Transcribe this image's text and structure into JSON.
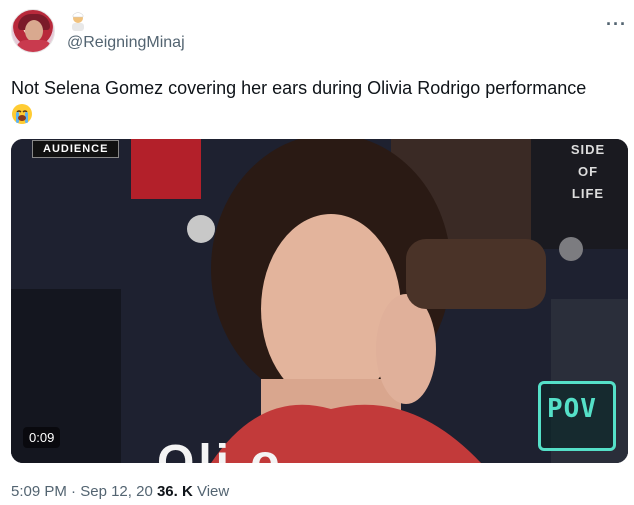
{
  "tweet": {
    "handle": "@ReigningMinaj",
    "text": "Not Selena Gomez covering her ears during Olivia Rodrigo performance",
    "more_icon": "more-icon"
  },
  "video": {
    "badge": "AUDIENCE",
    "duration": "0:09",
    "caption_overlay": "Oli   o",
    "logo_text": "POV",
    "side_text": "SIDE OF LIFE"
  },
  "meta": {
    "time": "5:09 PM",
    "separator": "·",
    "date": "Sep 12, 20",
    "views_count": "36. K",
    "views_label": "View"
  },
  "colors": {
    "text": "#0f1419",
    "muted": "#536471",
    "logo": "#55e0c8"
  }
}
